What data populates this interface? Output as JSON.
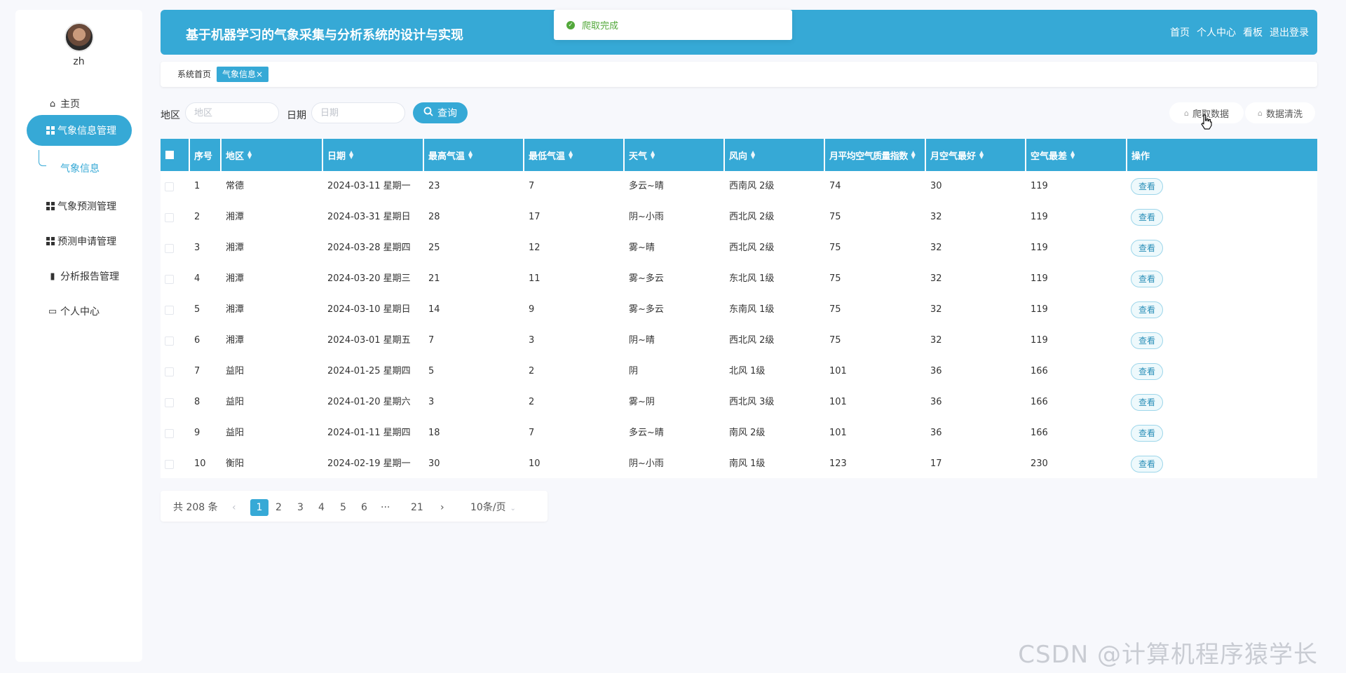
{
  "sidebar": {
    "username": "zh",
    "items": [
      {
        "label": "主页",
        "icon": "home-icon"
      },
      {
        "label": "气象信息管理",
        "icon": "grid-icon"
      },
      {
        "label": "气象预测管理",
        "icon": "grid-icon"
      },
      {
        "label": "预测申请管理",
        "icon": "grid-icon"
      },
      {
        "label": "分析报告管理",
        "icon": "report-icon"
      },
      {
        "label": "个人中心",
        "icon": "wallet-icon"
      }
    ],
    "sub_item": "气象信息"
  },
  "header": {
    "title": "基于机器学习的气象采集与分析系统的设计与实现",
    "nav": [
      "首页",
      "个人中心",
      "看板",
      "退出登录"
    ]
  },
  "toast": {
    "message": "爬取完成"
  },
  "tabs": [
    "系统首页",
    "气象信息"
  ],
  "tab_close": "×",
  "search": {
    "region_label": "地区",
    "region_placeholder": "地区",
    "date_label": "日期",
    "date_placeholder": "日期",
    "query_button": "查询",
    "crawl_button": "爬取数据",
    "clean_button": "数据清洗"
  },
  "table": {
    "columns": [
      "序号",
      "地区",
      "日期",
      "最高气温",
      "最低气温",
      "天气",
      "风向",
      "月平均空气质量指数",
      "月空气最好",
      "空气最差",
      "操作"
    ],
    "view_label": "查看",
    "rows": [
      [
        "1",
        "常德",
        "2024-03-11 星期一",
        "23",
        "7",
        "多云~晴",
        "西南风 2级",
        "74",
        "30",
        "119"
      ],
      [
        "2",
        "湘潭",
        "2024-03-31 星期日",
        "28",
        "17",
        "阴~小雨",
        "西北风 2级",
        "75",
        "32",
        "119"
      ],
      [
        "3",
        "湘潭",
        "2024-03-28 星期四",
        "25",
        "12",
        "雾~晴",
        "西北风 2级",
        "75",
        "32",
        "119"
      ],
      [
        "4",
        "湘潭",
        "2024-03-20 星期三",
        "21",
        "11",
        "雾~多云",
        "东北风 1级",
        "75",
        "32",
        "119"
      ],
      [
        "5",
        "湘潭",
        "2024-03-10 星期日",
        "14",
        "9",
        "雾~多云",
        "东南风 1级",
        "75",
        "32",
        "119"
      ],
      [
        "6",
        "湘潭",
        "2024-03-01 星期五",
        "7",
        "3",
        "阴~晴",
        "西北风 2级",
        "75",
        "32",
        "119"
      ],
      [
        "7",
        "益阳",
        "2024-01-25 星期四",
        "5",
        "2",
        "阴",
        "北风 1级",
        "101",
        "36",
        "166"
      ],
      [
        "8",
        "益阳",
        "2024-01-20 星期六",
        "3",
        "2",
        "雾~阴",
        "西北风 3级",
        "101",
        "36",
        "166"
      ],
      [
        "9",
        "益阳",
        "2024-01-11 星期四",
        "18",
        "7",
        "多云~晴",
        "南风 2级",
        "101",
        "36",
        "166"
      ],
      [
        "10",
        "衡阳",
        "2024-02-19 星期一",
        "30",
        "10",
        "阴~小雨",
        "南风 1级",
        "123",
        "17",
        "230"
      ]
    ]
  },
  "pagination": {
    "total": "共 208 条",
    "prev": "‹",
    "pages": [
      "1",
      "2",
      "3",
      "4",
      "5",
      "6",
      "···",
      "21"
    ],
    "current": "1",
    "next": "›",
    "page_size": "10条/页"
  },
  "watermark": "CSDN @计算机程序猿学长",
  "colors": {
    "accent": "#36a9d6",
    "success": "#52a83a"
  }
}
